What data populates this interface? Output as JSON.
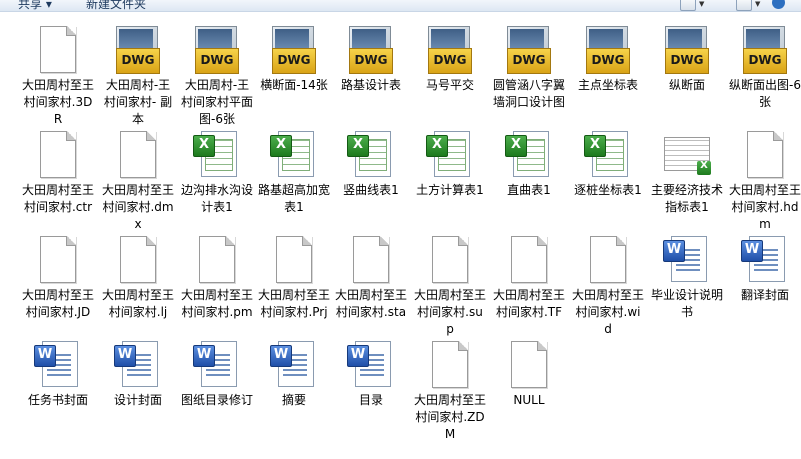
{
  "toolbar": {
    "share_label": "共享 ▾",
    "new_folder_label": "新建文件夹"
  },
  "rows": [
    [
      {
        "type": "blank",
        "label": "大田周村至王村间家村.3DR"
      },
      {
        "type": "dwg",
        "label": "大田周村-王村间家村- 副本"
      },
      {
        "type": "dwg",
        "label": "大田周村-王村间家村平面图-6张"
      },
      {
        "type": "dwg",
        "label": "横断面-14张"
      },
      {
        "type": "dwg",
        "label": "路基设计表"
      },
      {
        "type": "dwg",
        "label": "马号平交"
      },
      {
        "type": "dwg",
        "label": "圆管涵八字翼墙洞口设计图"
      },
      {
        "type": "dwg",
        "label": "主点坐标表"
      },
      {
        "type": "dwg",
        "label": "纵断面"
      },
      {
        "type": "dwg",
        "label": "纵断面出图-6张"
      }
    ],
    [
      {
        "type": "blank",
        "label": "大田周村至王村间家村.ctr"
      },
      {
        "type": "blank",
        "label": "大田周村至王村间家村.dmx"
      },
      {
        "type": "xls",
        "label": "边沟排水沟设计表1"
      },
      {
        "type": "xls",
        "label": "路基超高加宽表1"
      },
      {
        "type": "xls",
        "label": "竖曲线表1"
      },
      {
        "type": "xls",
        "label": "土方计算表1"
      },
      {
        "type": "xls",
        "label": "直曲表1"
      },
      {
        "type": "xls",
        "label": "逐桩坐标表1"
      },
      {
        "type": "xthumb",
        "label": "主要经济技术指标表1"
      },
      {
        "type": "blank",
        "label": "大田周村至王村间家村.hdm"
      }
    ],
    [
      {
        "type": "blank",
        "label": "大田周村至王村间家村.JD"
      },
      {
        "type": "blank",
        "label": "大田周村至王村间家村.lj"
      },
      {
        "type": "blank",
        "label": "大田周村至王村间家村.pm"
      },
      {
        "type": "blank",
        "label": "大田周村至王村间家村.Prj"
      },
      {
        "type": "blank",
        "label": "大田周村至王村间家村.sta"
      },
      {
        "type": "blank",
        "label": "大田周村至王村间家村.sup"
      },
      {
        "type": "blank",
        "label": "大田周村至王村间家村.TF"
      },
      {
        "type": "blank",
        "label": "大田周村至王村间家村.wid"
      },
      {
        "type": "doc",
        "label": "毕业设计说明书"
      },
      {
        "type": "doc",
        "label": "翻译封面"
      }
    ],
    [
      {
        "type": "doc",
        "label": "任务书封面"
      },
      {
        "type": "doc",
        "label": "设计封面"
      },
      {
        "type": "doc",
        "label": "图纸目录修订"
      },
      {
        "type": "doc",
        "label": "摘要"
      },
      {
        "type": "doc",
        "label": "目录"
      },
      {
        "type": "blank",
        "label": "大田周村至王村间家村.ZDM"
      },
      {
        "type": "blank",
        "label": "NULL"
      }
    ]
  ],
  "icon_text": {
    "dwg": "DWG",
    "xls": "X",
    "doc": "W"
  }
}
